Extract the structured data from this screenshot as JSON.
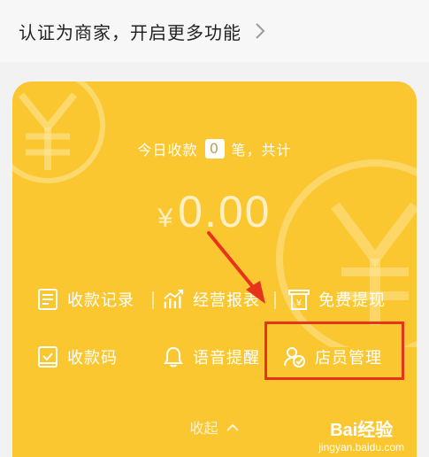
{
  "banner": {
    "text": "认证为商家，开启更多功能",
    "icon": "chevron-right-icon"
  },
  "summary": {
    "prefix": "今日收款",
    "count": "0",
    "suffix": "笔，共计"
  },
  "amount": {
    "currency": "¥",
    "value": "0.00"
  },
  "actions": [
    {
      "label": "收款记录",
      "icon": "receipt-list-icon"
    },
    {
      "label": "经营报表",
      "icon": "bar-chart-icon"
    },
    {
      "label": "免费提现",
      "icon": "withdraw-icon"
    },
    {
      "label": "收款码",
      "icon": "qr-code-book-icon"
    },
    {
      "label": "语音提醒",
      "icon": "bell-icon"
    },
    {
      "label": "店员管理",
      "icon": "staff-manage-icon"
    }
  ],
  "collapse_label": "收起",
  "watermark": {
    "brand": "Bai经验",
    "url": "jingyan.baidu.com"
  },
  "colors": {
    "card_bg": "#fbc730",
    "highlight": "#e8331c"
  }
}
